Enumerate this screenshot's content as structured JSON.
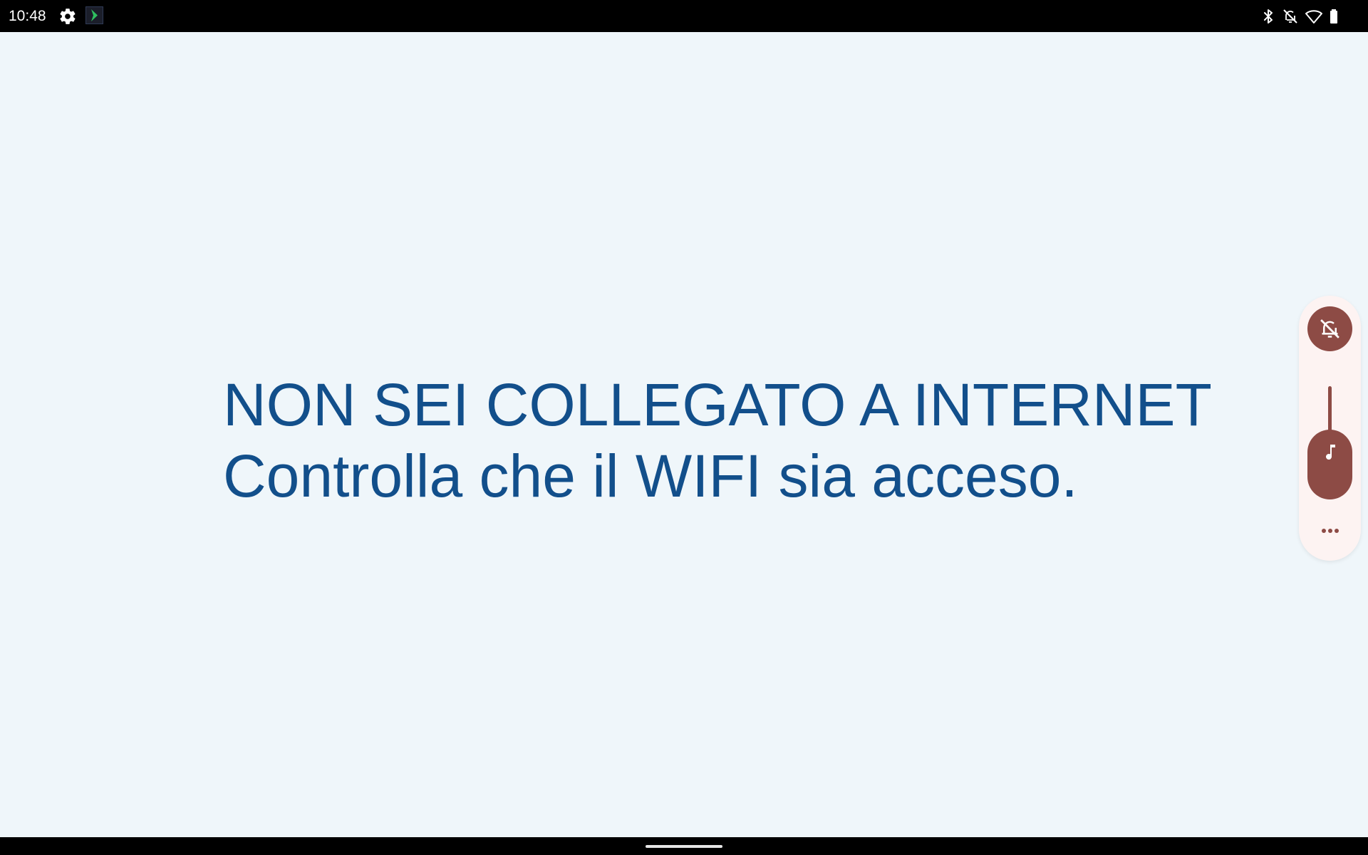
{
  "status_bar": {
    "time": "10:48",
    "left_icons": [
      "gear-icon",
      "app-notification-icon"
    ],
    "right_icons": [
      "bluetooth-icon",
      "notifications-off-icon",
      "wifi-icon",
      "battery-icon"
    ]
  },
  "message": {
    "title": "NON SEI COLLEGATO A INTERNET",
    "subtitle": "Controlla che il WIFI sia acceso."
  },
  "volume_panel": {
    "ringer_icon": "bell-off-icon",
    "slider_icon": "music-note-icon",
    "more_icon": "more-horizontal-icon",
    "accent_color": "#8d4b45"
  },
  "colors": {
    "background": "#eff6fa",
    "message_text": "#124f8b",
    "bars": "#000000"
  }
}
